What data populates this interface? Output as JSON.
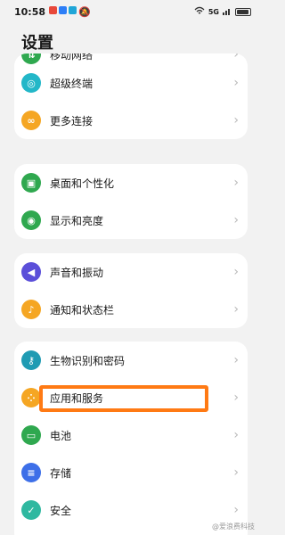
{
  "status_bar": {
    "time": "10:58",
    "app_icon_colors": [
      "#e8483a",
      "#2d7ef7",
      "#20a6d8"
    ],
    "signal_text": "5G",
    "icons": [
      "mute-icon",
      "wifi-icon",
      "signal-icon",
      "battery-icon"
    ]
  },
  "page_title": "设置",
  "groups": [
    {
      "items": [
        {
          "label": "移动网络",
          "icon": "mobile-network-icon",
          "color": "#2fa84f"
        },
        {
          "label": "超级终端",
          "icon": "super-device-icon",
          "color": "#23b7c8"
        },
        {
          "label": "更多连接",
          "icon": "link-icon",
          "color": "#f5a623"
        }
      ]
    },
    {
      "items": [
        {
          "label": "桌面和个性化",
          "icon": "wallpaper-icon",
          "color": "#2fa84f"
        },
        {
          "label": "显示和亮度",
          "icon": "eye-icon",
          "color": "#2fa84f"
        }
      ]
    },
    {
      "items": [
        {
          "label": "声音和振动",
          "icon": "volume-icon",
          "color": "#5b4fd9"
        },
        {
          "label": "通知和状态栏",
          "icon": "bell-icon",
          "color": "#f5a623"
        }
      ]
    },
    {
      "items": [
        {
          "label": "生物识别和密码",
          "icon": "key-icon",
          "color": "#1f9bb3"
        },
        {
          "label": "应用和服务",
          "icon": "apps-icon",
          "color": "#f5a623"
        },
        {
          "label": "电池",
          "icon": "battery-icon",
          "color": "#2fa84f"
        },
        {
          "label": "存储",
          "icon": "storage-icon",
          "color": "#3d6fe8"
        },
        {
          "label": "安全",
          "icon": "shield-icon",
          "color": "#2fb8a0"
        }
      ]
    }
  ],
  "highlight_color": "#ff7a14",
  "watermark": "@爱浪费科技"
}
